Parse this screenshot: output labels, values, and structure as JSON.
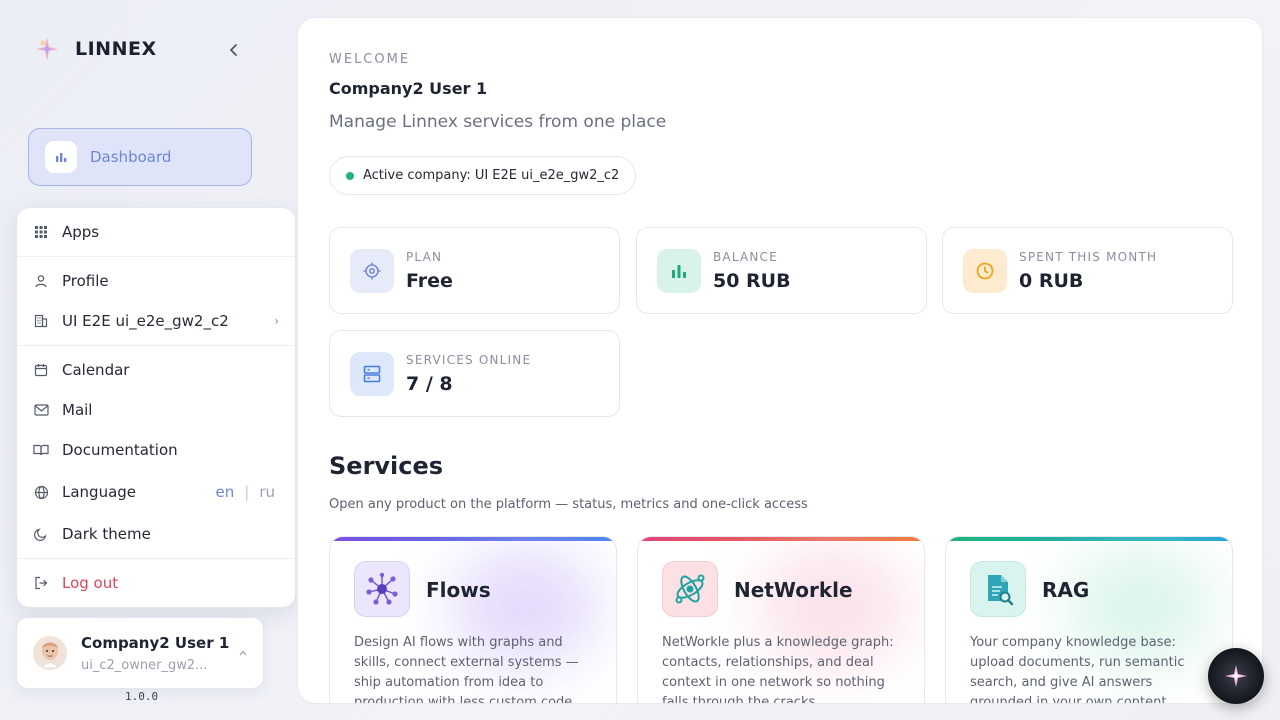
{
  "app": {
    "name": "LINNEX",
    "version": "1.0.0"
  },
  "nav": {
    "dashboard_label": "Dashboard"
  },
  "menu": {
    "apps": "Apps",
    "profile": "Profile",
    "company": "UI E2E ui_e2e_gw2_c2",
    "calendar": "Calendar",
    "mail": "Mail",
    "documentation": "Documentation",
    "language": "Language",
    "lang_en": "en",
    "lang_sep": "|",
    "lang_ru": "ru",
    "dark_theme": "Dark theme",
    "logout": "Log out"
  },
  "user": {
    "name": "Company2 User 1",
    "login": "ui_c2_owner_gw2..."
  },
  "main": {
    "welcome": "WELCOME",
    "user_name": "Company2 User 1",
    "tagline": "Manage Linnex services from one place",
    "active_company": "Active company: UI E2E ui_e2e_gw2_c2"
  },
  "stats": [
    {
      "label": "PLAN",
      "value": "Free",
      "icon": "target-icon",
      "bg": "#e7eaf8",
      "fg": "#7b8ad6"
    },
    {
      "label": "BALANCE",
      "value": "50 RUB",
      "icon": "bar-chart-icon",
      "bg": "#d9f3ea",
      "fg": "#1fa978"
    },
    {
      "label": "SPENT THIS MONTH",
      "value": "0 RUB",
      "icon": "clock-icon",
      "bg": "#fdebd0",
      "fg": "#f0a41d"
    },
    {
      "label": "SERVICES ONLINE",
      "value": "7 / 8",
      "icon": "server-icon",
      "bg": "#dde8fb",
      "fg": "#4a7de0"
    }
  ],
  "services": {
    "title": "Services",
    "subtitle": "Open any product on the platform — status, metrics and one-click access",
    "items": [
      {
        "name": "Flows",
        "description": "Design AI flows with graphs and skills, connect external systems — ship automation from idea to production with less custom code",
        "icon": "flows-network-icon"
      },
      {
        "name": "NetWorkle",
        "description": "NetWorkle plus a knowledge graph: contacts, relationships, and deal context in one network so nothing falls through the cracks",
        "icon": "networkle-icon"
      },
      {
        "name": "RAG",
        "description": "Your company knowledge base: upload documents, run semantic search, and give AI answers grounded in your own content",
        "icon": "document-search-icon"
      }
    ]
  },
  "colors": {
    "accent": "#6f85d8",
    "danger": "#e0435c",
    "success": "#22b378"
  }
}
